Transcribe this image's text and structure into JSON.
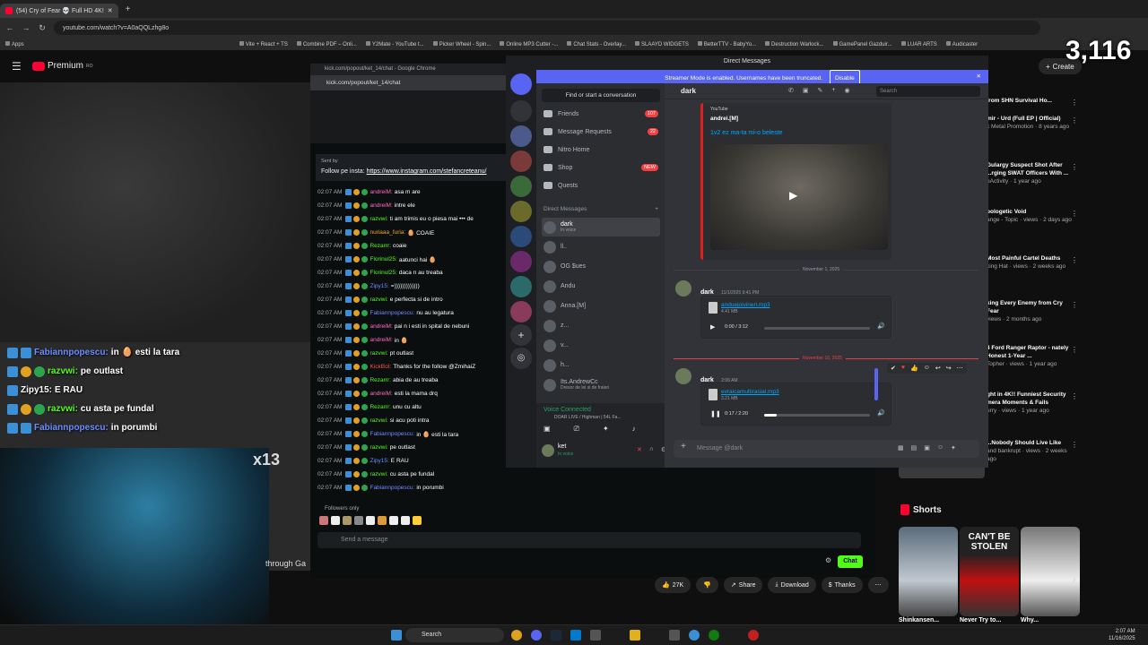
{
  "browser": {
    "tab_title": "(54) Cry of Fear 💀 Full HD 4K!",
    "url": "youtube.com/watch?v=A0aQQLzhg8o",
    "bookmarks": [
      "Apps",
      "Combine PDF – Onli...",
      "Y2Mate - YouTube t...",
      "Picker Wheel - Spin...",
      "Online MP3 Cutter -...",
      "Chat Stats - Overlay...",
      "SLAAYD WIDGETS",
      "BetterTTV - BabyYo...",
      "Destruction Warlock...",
      "GamePanel Gazduir...",
      "LUAR ARTS",
      "Audicaster"
    ],
    "bookmark_vite": "Vite + React + TS"
  },
  "youtube": {
    "logo_text": "Premium",
    "logo_sup": "RO",
    "create_label": "Create",
    "counter": "3,116",
    "title_strip": "through Ga",
    "actions": {
      "likes": "27K",
      "share": "Share",
      "download": "Download",
      "thanks": "Thanks"
    },
    "recommendations": [
      {
        "title": "from SHN Survival Ho...",
        "meta": ""
      },
      {
        "title": "mir - Urd (Full EP | Official)",
        "meta": "k Metal Promotion · 8 years ago"
      },
      {
        "title": "Gulargy Suspect Shot After ...rging SWAT Officers With ...",
        "meta": "oActivity · 1 year ago"
      },
      {
        "title": "pologetic Void",
        "meta": "ange - Topic · views · 2 days ago"
      },
      {
        "title": "Most Painful Cartel Deaths",
        "meta": "king Hat · views · 2 weeks ago"
      },
      {
        "title": "king Every Enemy from Cry Fear",
        "meta": "views · 2 months ago"
      },
      {
        "title": "4 Ford Ranger Raptor - nately Honest 1-Year ...",
        "meta": "Topher · views · 1 year ago"
      },
      {
        "title": "ght in 4K!! Funniest Security mera Moments & Fails",
        "meta": "urry · views · 1 year ago"
      },
      {
        "title": "...Nobody Should Live Like",
        "meta": "and bankrupt · views · 2 weeks ago"
      }
    ],
    "shorts_label": "Shorts",
    "shorts": [
      {
        "caption": "Shinkansen..."
      },
      {
        "caption": "Never Try to...",
        "overlay": "CAN'T BE STOLEN"
      },
      {
        "caption": "Why..."
      }
    ]
  },
  "overlay_chat": [
    {
      "user": "Fabiannpopescu:",
      "text": "in 🥚 esti la tara"
    },
    {
      "user": "razvwi:",
      "text": "pe outlast"
    },
    {
      "user": "Zipy15:",
      "text": "E RAU"
    },
    {
      "user": "razvwi:",
      "text": "cu asta pe fundal"
    },
    {
      "user": "Fabiannpopescu:",
      "text": "in porumbi"
    }
  ],
  "x13": "x13",
  "kick": {
    "window_title": "kick.com/popout/ket_14/chat - Google Chrome",
    "url": "kick.com/popout/ket_14/chat",
    "pinned_sent_by": "Sent by",
    "pinned_text": "Follow pe insta:",
    "pinned_link": "https://www.instagram.com/stefancreteanu/",
    "messages": [
      {
        "time": "02:07 AM",
        "user": "andreiM:",
        "text": "asa m are",
        "color": "u-pink"
      },
      {
        "time": "02:07 AM",
        "user": "andreiM:",
        "text": "intre ele",
        "color": "u-pink"
      },
      {
        "time": "02:07 AM",
        "user": "razvwi:",
        "text": "ti am trimis eu o piesa mai ••• de",
        "color": "u-green"
      },
      {
        "time": "02:07 AM",
        "user": "nuriaaa_furia:",
        "text": "🥚 COAIE",
        "color": "u-orange"
      },
      {
        "time": "02:07 AM",
        "user": "Rezarrr:",
        "text": "coaie",
        "color": "u-green"
      },
      {
        "time": "02:07 AM",
        "user": "Florinul25:",
        "text": "aatunci hai 🥚",
        "color": "u-green"
      },
      {
        "time": "02:07 AM",
        "user": "Florinul25:",
        "text": "daca n au treaba",
        "color": "u-green"
      },
      {
        "time": "02:07 AM",
        "user": "Zipy15:",
        "text": "=)))))))))))))",
        "color": "u-blue"
      },
      {
        "time": "02:07 AM",
        "user": "razvwi:",
        "text": "e perfecta si de intro",
        "color": "u-green"
      },
      {
        "time": "02:07 AM",
        "user": "Fabiannpopescu:",
        "text": "nu au legatura",
        "color": "u-blue"
      },
      {
        "time": "02:07 AM",
        "user": "andreiM:",
        "text": "pai n i esti in spital de nebuni",
        "color": "u-pink"
      },
      {
        "time": "02:07 AM",
        "user": "andreiM:",
        "text": "in 🥚",
        "color": "u-pink"
      },
      {
        "time": "02:07 AM",
        "user": "razvwi:",
        "text": "pt outlast",
        "color": "u-green"
      },
      {
        "time": "02:07 AM",
        "user": "KickBot:",
        "text": "Thanks for the follow @ZmihaiZ",
        "color": "u-red"
      },
      {
        "time": "02:07 AM",
        "user": "Rezarrr:",
        "text": "abia de au treaba",
        "color": "u-green"
      },
      {
        "time": "02:07 AM",
        "user": "andreiM:",
        "text": "esti la mama drq",
        "color": "u-pink"
      },
      {
        "time": "02:07 AM",
        "user": "Rezarrr:",
        "text": "unu cu altu",
        "color": "u-green"
      },
      {
        "time": "02:07 AM",
        "user": "razvwi:",
        "text": "si acu poti intra",
        "color": "u-green"
      },
      {
        "time": "02:07 AM",
        "user": "Fabiannpopescu:",
        "text": "in 🥚 esti la tara",
        "color": "u-blue"
      },
      {
        "time": "02:07 AM",
        "user": "razvwi:",
        "text": "pe outlast",
        "color": "u-green"
      },
      {
        "time": "02:07 AM",
        "user": "Zipy15:",
        "text": "E RAU",
        "color": "u-blue"
      },
      {
        "time": "02:07 AM",
        "user": "razvwi:",
        "text": "cu asta pe fundal",
        "color": "u-green"
      },
      {
        "time": "02:07 AM",
        "user": "Fabiannpopescu:",
        "text": "in porumbi",
        "color": "u-blue"
      }
    ],
    "followers_only": "Followers only",
    "input_placeholder": "Send a message",
    "chat_button": "Chat"
  },
  "discord": {
    "title": "Direct Messages",
    "banner": "Streamer Mode is enabled. Usernames have been truncated.",
    "banner_button": "Disable",
    "search_placeholder": "Find or start a conversation",
    "nav": [
      {
        "label": "Friends",
        "badge": "107"
      },
      {
        "label": "Message Requests",
        "badge": "22"
      },
      {
        "label": "Nitro Home",
        "badge": ""
      },
      {
        "label": "Shop",
        "badge": "NEW"
      },
      {
        "label": "Quests",
        "badge": ""
      }
    ],
    "dm_header": "Direct Messages",
    "dms": [
      {
        "name": "dark",
        "sub": "In voice",
        "selected": true
      },
      {
        "name": "ll..",
        "sub": ""
      },
      {
        "name": "OG $ues",
        "sub": ""
      },
      {
        "name": "Andu",
        "sub": ""
      },
      {
        "name": "Anna.[M]",
        "sub": ""
      },
      {
        "name": "z...",
        "sub": ""
      },
      {
        "name": "v...",
        "sub": ""
      },
      {
        "name": "h...",
        "sub": ""
      },
      {
        "name": "Its.AndrewCc",
        "sub": "Dresor de lei si de fraieri"
      }
    ],
    "voice_status": "Voice Connected",
    "voice_channel": "DOAR LIVE / Highman | 54L Fa...",
    "self_name": "ket",
    "self_status": "In voice",
    "chat_title": "dark",
    "chat_search": "Search",
    "embed": {
      "provider": "YouTube",
      "author": "andrei.[M]",
      "title": "1v2 ez ma-ta mi-o beleste"
    },
    "date1": "November 1, 2025",
    "msg1": {
      "author": "dark",
      "time": "11/1/2025 9:41 PM",
      "file": "anduejoivineri.mp3",
      "size": "4.41 MB",
      "player": "0:00 / 3:12",
      "progress": 0
    },
    "date2": "November 16, 2025",
    "msg2": {
      "author": "dark",
      "time": "2:06 AM",
      "file": "evraicamultirasial.mp3",
      "size": "3.21 MB",
      "player": "0:17 / 2:20",
      "progress": 0.12
    },
    "composer_placeholder": "Message @dark"
  },
  "taskbar": {
    "search": "Search",
    "time": "2:07 AM",
    "date": "11/16/2025"
  }
}
